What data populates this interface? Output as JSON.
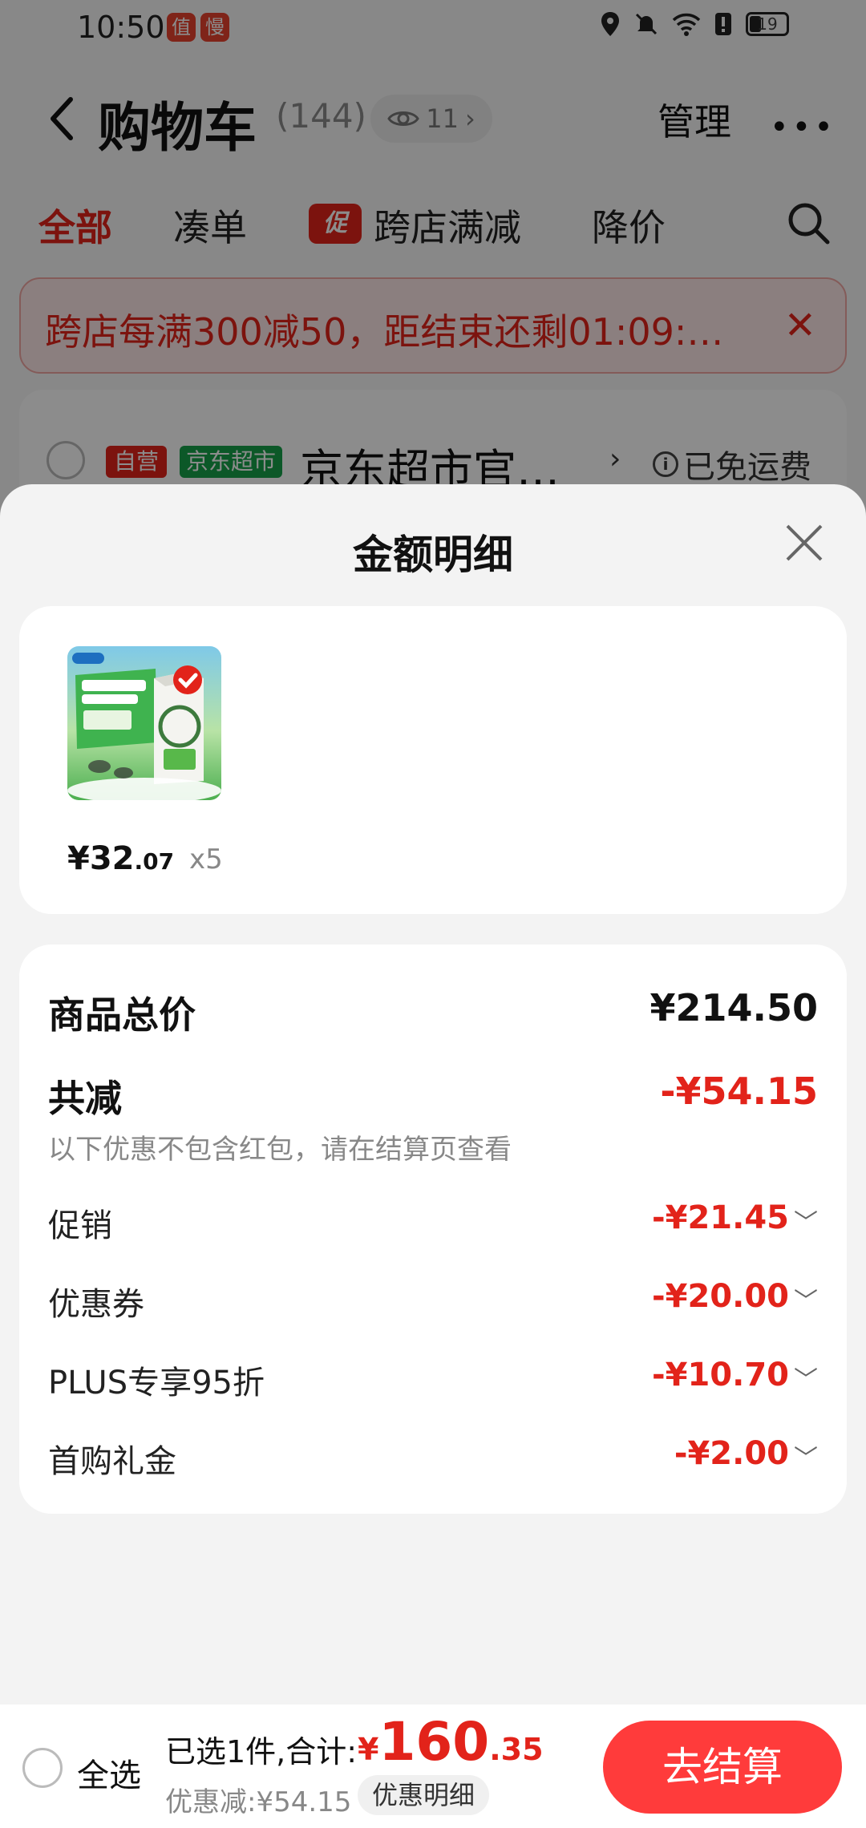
{
  "status_bar": {
    "time": "10:50",
    "app_badge_1": "值",
    "app_badge_2": "慢",
    "battery": "19"
  },
  "header": {
    "title": "购物车",
    "count": "(144)",
    "follow_count": "11",
    "manage": "管理"
  },
  "tabs": [
    {
      "label": "全部"
    },
    {
      "label": "凑单"
    },
    {
      "label": "跨店满减",
      "tag": "促"
    },
    {
      "label": "降价"
    }
  ],
  "promo_banner": {
    "text": "跨店每满300减50，距结束还剩01:09:…"
  },
  "store": {
    "tag_self": "自营",
    "tag_jd": "京东超市",
    "name": "京东超市官…",
    "shipping": "已免运费"
  },
  "sheet": {
    "title": "金额明细",
    "item": {
      "price_main": "¥32",
      "price_decimal": ".07",
      "qty": "x5"
    },
    "total_label": "商品总价",
    "total_value": "¥214.50",
    "reduce_label": "共减",
    "reduce_value": "-¥54.15",
    "note": "以下优惠不包含红包，请在结算页查看",
    "items": [
      {
        "label": "促销",
        "value": "-¥21.45"
      },
      {
        "label": "优惠券",
        "value": "-¥20.00"
      },
      {
        "label": "PLUS专享95折",
        "value": "-¥10.70"
      },
      {
        "label": "首购礼金",
        "value": "-¥2.00"
      }
    ]
  },
  "bottom_bar": {
    "select_all": "全选",
    "selected_summary": "已选1件,合计:",
    "total_currency": "¥",
    "total_int": "160",
    "total_dec": ".35",
    "discount_line": "优惠减:¥54.15",
    "discount_detail": "优惠明细",
    "checkout": "去结算"
  },
  "colors": {
    "accent": "#e2231a",
    "checkout": "#ff3b3b",
    "jd_green": "#17a04a"
  }
}
